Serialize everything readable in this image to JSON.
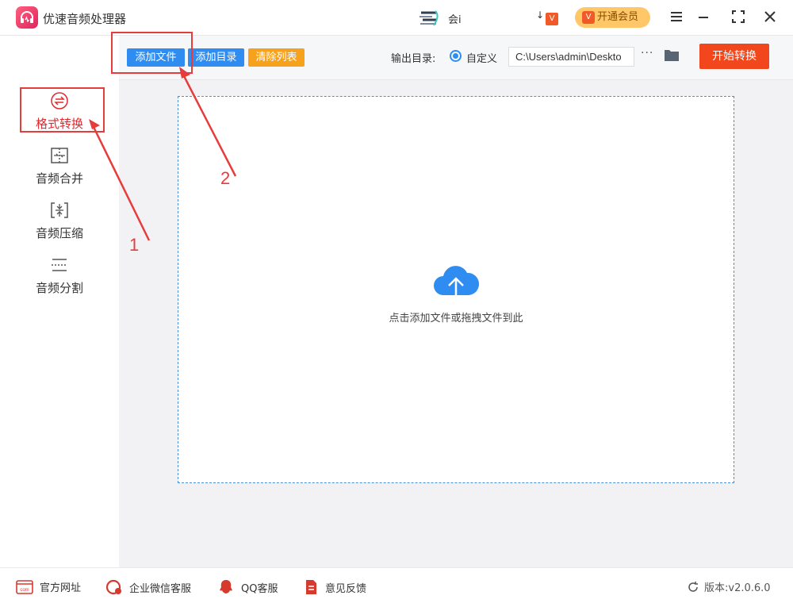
{
  "app": {
    "title": "优速音频处理器"
  },
  "header": {
    "user_name": "会i",
    "vip_small_prefix": "↓",
    "vip_small_badge": "V",
    "vip_button_badge": "V",
    "vip_button_label": "开通会员"
  },
  "sidebar": {
    "items": [
      {
        "label": "格式转换",
        "icon": "convert-icon",
        "active": true
      },
      {
        "label": "音频合并",
        "icon": "merge-icon",
        "active": false
      },
      {
        "label": "音频压缩",
        "icon": "compress-icon",
        "active": false
      },
      {
        "label": "音频分割",
        "icon": "split-icon",
        "active": false
      }
    ]
  },
  "toolbar": {
    "add_file": "添加文件",
    "add_folder": "添加目录",
    "clear_list": "清除列表",
    "output_label": "输出目录:",
    "custom_option": "自定义",
    "output_path": "C:\\Users\\admin\\Deskto",
    "more": "···",
    "start_button": "开始转换"
  },
  "main": {
    "drop_hint": "点击添加文件或拖拽文件到此"
  },
  "footer": {
    "website": "官方网址",
    "wechat_support": "企业微信客服",
    "qq_support": "QQ客服",
    "feedback": "意见反馈",
    "version": "版本:v2.0.6.0"
  },
  "annotations": {
    "step1": "1",
    "step2": "2"
  },
  "colors": {
    "accent_red": "#e0282f",
    "add_file_blue": "#2f8cf0",
    "clear_orange": "#f7a21d",
    "start_red": "#f2471c",
    "vip_gold": "#ffc768",
    "annotation_red": "#e73c3c"
  }
}
